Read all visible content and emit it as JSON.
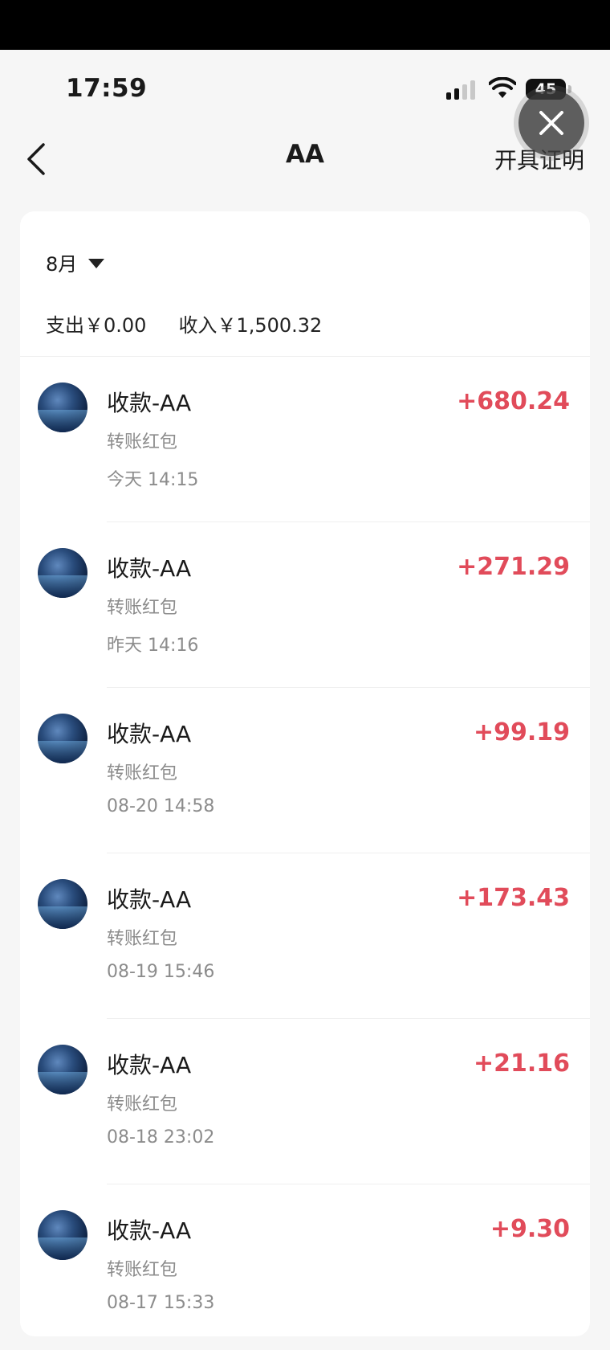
{
  "status_bar": {
    "time": "17:59",
    "battery": "45"
  },
  "nav": {
    "title": "AA",
    "right_action": "开具证明"
  },
  "summary": {
    "month": "8月",
    "expense": "支出￥0.00",
    "income": "收入￥1,500.32"
  },
  "transactions": [
    {
      "name": "收款-AA",
      "kind": "转账红包",
      "time": "今天 14:15",
      "amount": "+680.24"
    },
    {
      "name": "收款-AA",
      "kind": "转账红包",
      "time": "昨天 14:16",
      "amount": "+271.29"
    },
    {
      "name": "收款-AA",
      "kind": "转账红包",
      "time": "08-20 14:58",
      "amount": "+99.19"
    },
    {
      "name": "收款-AA",
      "kind": "转账红包",
      "time": "08-19 15:46",
      "amount": "+173.43"
    },
    {
      "name": "收款-AA",
      "kind": "转账红包",
      "time": "08-18 23:02",
      "amount": "+21.16"
    },
    {
      "name": "收款-AA",
      "kind": "转账红包",
      "time": "08-17 15:33",
      "amount": "+9.30"
    }
  ],
  "colors": {
    "income_red": "#e14b5a",
    "background": "#f6f6f6"
  },
  "icons": {
    "back": "chevron-left-icon",
    "close": "close-icon",
    "dropdown": "caret-down-icon",
    "signal": "cellular-signal-icon",
    "wifi": "wifi-icon",
    "battery": "battery-icon"
  }
}
